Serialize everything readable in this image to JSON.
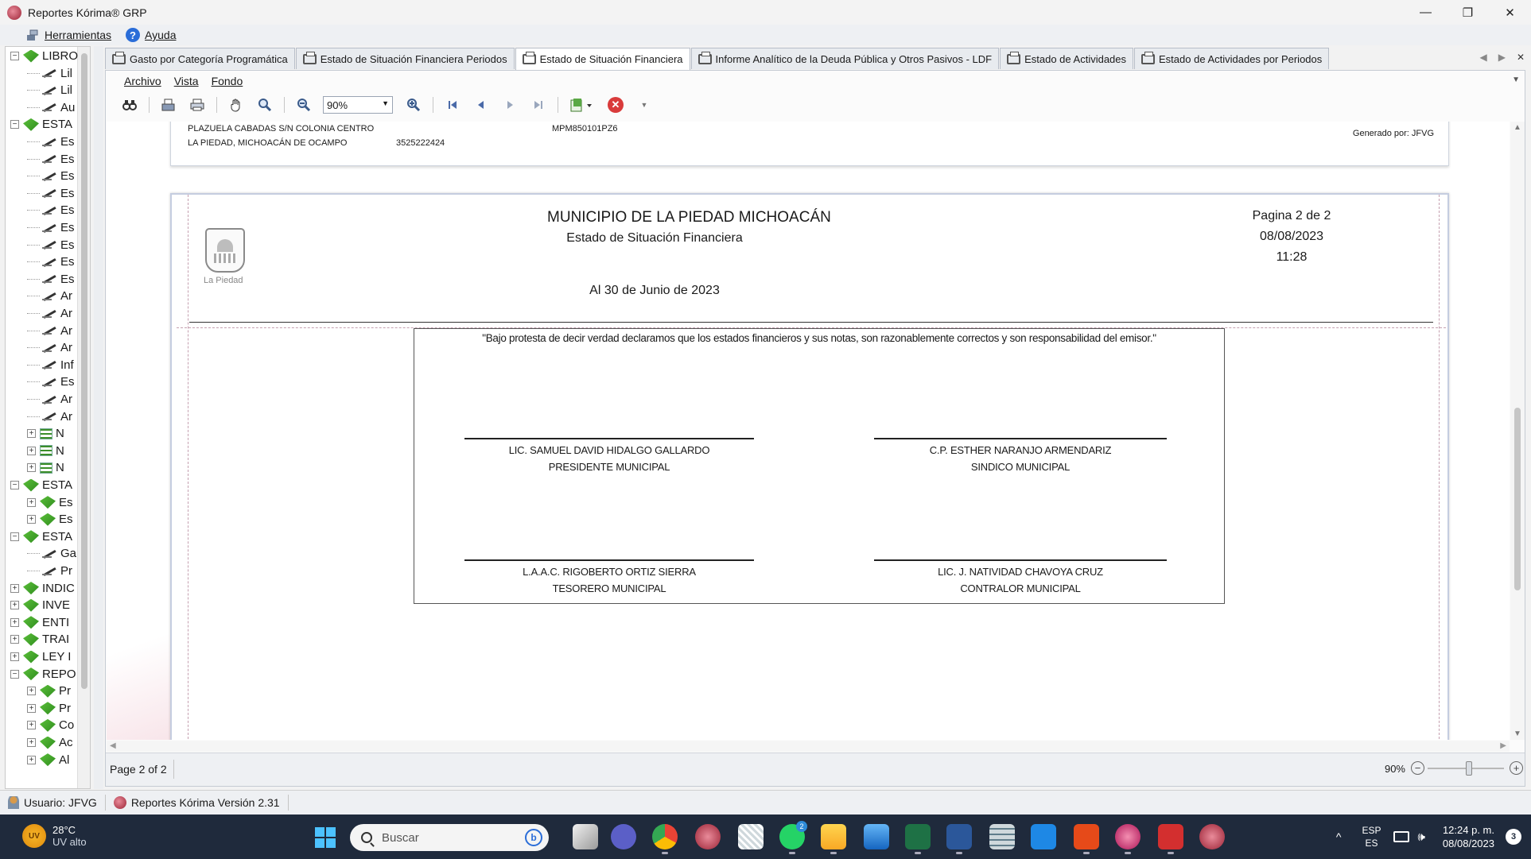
{
  "window": {
    "title": "Reportes Kórima® GRP",
    "minimize": "—",
    "restore": "❐",
    "close": "✕"
  },
  "main_menu": {
    "tools": "Herramientas",
    "help": "Ayuda",
    "help_glyph": "?"
  },
  "tree": {
    "items": [
      {
        "type": "book",
        "label": "LIBRO",
        "level": 0,
        "expander": "−"
      },
      {
        "type": "pen",
        "label": "Lil",
        "level": 1
      },
      {
        "type": "pen",
        "label": "Lil",
        "level": 1
      },
      {
        "type": "pen",
        "label": "Au",
        "level": 1
      },
      {
        "type": "book",
        "label": "ESTA",
        "level": 0,
        "expander": "−"
      },
      {
        "type": "pen",
        "label": "Es",
        "level": 1
      },
      {
        "type": "pen",
        "label": "Es",
        "level": 1
      },
      {
        "type": "pen",
        "label": "Es",
        "level": 1
      },
      {
        "type": "pen",
        "label": "Es",
        "level": 1
      },
      {
        "type": "pen",
        "label": "Es",
        "level": 1
      },
      {
        "type": "pen",
        "label": "Es",
        "level": 1
      },
      {
        "type": "pen",
        "label": "Es",
        "level": 1
      },
      {
        "type": "pen",
        "label": "Es",
        "level": 1
      },
      {
        "type": "pen",
        "label": "Es",
        "level": 1
      },
      {
        "type": "pen",
        "label": "Ar",
        "level": 1
      },
      {
        "type": "pen",
        "label": "Ar",
        "level": 1
      },
      {
        "type": "pen",
        "label": "Ar",
        "level": 1
      },
      {
        "type": "pen",
        "label": "Ar",
        "level": 1
      },
      {
        "type": "pen",
        "label": "Inf",
        "level": 1
      },
      {
        "type": "pen",
        "label": "Es",
        "level": 1
      },
      {
        "type": "pen",
        "label": "Ar",
        "level": 1
      },
      {
        "type": "pen",
        "label": "Ar",
        "level": 1
      },
      {
        "type": "list",
        "label": "N",
        "level": 1,
        "expander": "+"
      },
      {
        "type": "list",
        "label": "N",
        "level": 1,
        "expander": "+"
      },
      {
        "type": "list",
        "label": "N",
        "level": 1,
        "expander": "+"
      },
      {
        "type": "book",
        "label": "ESTA",
        "level": 0,
        "expander": "−"
      },
      {
        "type": "book",
        "label": "Es",
        "level": 1,
        "expander": "+"
      },
      {
        "type": "book",
        "label": "Es",
        "level": 1,
        "expander": "+"
      },
      {
        "type": "book",
        "label": "ESTA",
        "level": 0,
        "expander": "−"
      },
      {
        "type": "pen",
        "label": "Ga",
        "level": 1
      },
      {
        "type": "pen",
        "label": "Pr",
        "level": 1
      },
      {
        "type": "book",
        "label": "INDIC",
        "level": 0,
        "expander": "+"
      },
      {
        "type": "book",
        "label": "INVE",
        "level": 0,
        "expander": "+"
      },
      {
        "type": "book",
        "label": "ENTI",
        "level": 0,
        "expander": "+"
      },
      {
        "type": "book",
        "label": "TRAI",
        "level": 0,
        "expander": "+"
      },
      {
        "type": "book",
        "label": "LEY I",
        "level": 0,
        "expander": "+"
      },
      {
        "type": "book",
        "label": "REPO",
        "level": 0,
        "expander": "−"
      },
      {
        "type": "book",
        "label": "Pr",
        "level": 1,
        "expander": "+"
      },
      {
        "type": "book",
        "label": "Pr",
        "level": 1,
        "expander": "+"
      },
      {
        "type": "book",
        "label": "Co",
        "level": 1,
        "expander": "+"
      },
      {
        "type": "book",
        "label": "Ac",
        "level": 1,
        "expander": "+"
      },
      {
        "type": "book",
        "label": "Al",
        "level": 1,
        "expander": "+"
      }
    ]
  },
  "tabs": [
    {
      "label": "Gasto por Categoría Programática",
      "active": false
    },
    {
      "label": "Estado de Situación Financiera Periodos",
      "active": false
    },
    {
      "label": "Estado de Situación Financiera",
      "active": true
    },
    {
      "label": "Informe Analítico de la Deuda Pública y Otros Pasivos - LDF",
      "active": false
    },
    {
      "label": "Estado de Actividades",
      "active": false
    },
    {
      "label": "Estado de Actividades por Periodos",
      "active": false
    }
  ],
  "tab_nav": {
    "prev": "◀",
    "next": "▶",
    "close": "✕"
  },
  "viewer_menu": {
    "file": "Archivo",
    "view": "Vista",
    "background": "Fondo",
    "dropdown": "▼"
  },
  "toolbar": {
    "zoom_value": "90%",
    "zoom_arrow": "▼",
    "stop_glyph": "✕"
  },
  "report_page1": {
    "address_line1": "PLAZUELA CABADAS S/N COLONIA CENTRO",
    "address_line2": "LA PIEDAD, MICHOACÁN DE OCAMPO",
    "phone": "3525222424",
    "rfc": "MPM850101PZ6",
    "generated_by": "Generado por: JFVG"
  },
  "report_page2": {
    "entity": "MUNICIPIO DE LA PIEDAD MICHOACÁN",
    "report_name": "Estado de Situación Financiera",
    "period": "Al 30 de Junio de 2023",
    "page_info": "Pagina 2 de 2",
    "date": "08/08/2023",
    "time": "11:28",
    "logo_label": "La Piedad",
    "declaration": "\"Bajo protesta de decir verdad declaramos que los estados financieros y sus notas, son razonablemente correctos y son responsabilidad del emisor.\"",
    "signatures": [
      {
        "name": "LIC. SAMUEL DAVID HIDALGO GALLARDO",
        "title": "PRESIDENTE MUNICIPAL"
      },
      {
        "name": "C.P. ESTHER NARANJO ARMENDARIZ",
        "title": "SINDICO MUNICIPAL"
      },
      {
        "name": "L.A.A.C. RIGOBERTO ORTIZ SIERRA",
        "title": "TESORERO MUNICIPAL"
      },
      {
        "name": "LIC. J. NATIVIDAD CHAVOYA CRUZ",
        "title": "CONTRALOR MUNICIPAL"
      }
    ]
  },
  "viewer_status": {
    "page_label": "Page 2 of 2",
    "zoom": "90%",
    "zoom_level_percent": 90,
    "minus": "−",
    "plus": "+"
  },
  "app_status": {
    "user": "Usuario: JFVG",
    "version": "Reportes Kórima Versión 2.31"
  },
  "taskbar": {
    "weather_badge": "UV",
    "temperature": "28°C",
    "weather_desc": "UV alto",
    "search_placeholder": "Buscar",
    "bing": "b",
    "whatsapp_badge": "2",
    "tray_chevron": "^",
    "lang_top": "ESP",
    "lang_bottom": "ES",
    "volume": "🕪",
    "time": "12:24 p. m.",
    "date": "08/08/2023",
    "notifications": "3"
  }
}
